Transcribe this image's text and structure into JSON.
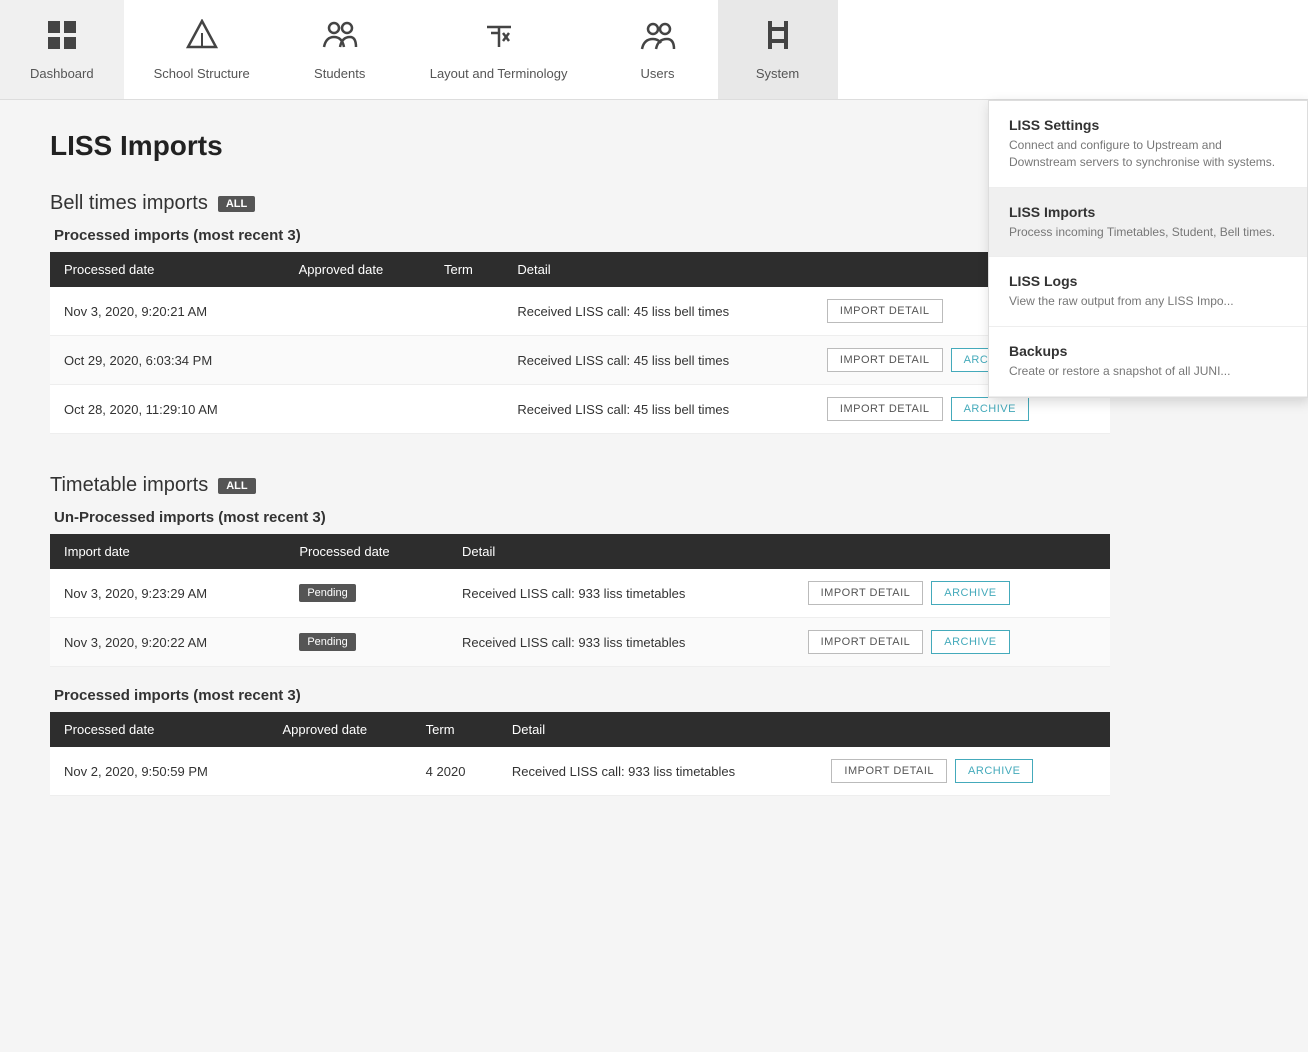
{
  "nav": {
    "items": [
      {
        "id": "dashboard",
        "label": "Dashboard",
        "icon": "⊞"
      },
      {
        "id": "school-structure",
        "label": "School Structure",
        "icon": "△"
      },
      {
        "id": "students",
        "label": "Students",
        "icon": "👥"
      },
      {
        "id": "layout-terminology",
        "label": "Layout and Terminology",
        "icon": "✂"
      },
      {
        "id": "users",
        "label": "Users",
        "icon": "👤"
      },
      {
        "id": "system",
        "label": "System",
        "icon": "⚙"
      }
    ],
    "active": "system"
  },
  "dropdown": {
    "items": [
      {
        "id": "liss-settings",
        "title": "LISS Settings",
        "desc": "Connect and configure to Upstream and Downstream servers to synchronise with systems."
      },
      {
        "id": "liss-imports",
        "title": "LISS Imports",
        "desc": "Process incoming Timetables, Student, Bell times.",
        "active": true
      },
      {
        "id": "liss-logs",
        "title": "LISS Logs",
        "desc": "View the raw output from any LISS Impo..."
      },
      {
        "id": "backups",
        "title": "Backups",
        "desc": "Create or restore a snapshot of all JUNI..."
      }
    ]
  },
  "page": {
    "title": "LISS Imports"
  },
  "bell_times": {
    "section_title": "Bell times imports",
    "badge": "ALL",
    "processed_title": "Processed imports (most recent 3)",
    "table_headers": [
      "Processed date",
      "Approved date",
      "Term",
      "Detail"
    ],
    "rows": [
      {
        "processed_date": "Nov 3, 2020, 9:20:21 AM",
        "approved_date": "",
        "term": "",
        "detail": "Received LISS call: 45 liss bell times",
        "show_archive": false
      },
      {
        "processed_date": "Oct 29, 2020, 6:03:34 PM",
        "approved_date": "",
        "term": "",
        "detail": "Received LISS call: 45 liss bell times",
        "show_archive": true
      },
      {
        "processed_date": "Oct 28, 2020, 11:29:10 AM",
        "approved_date": "",
        "term": "",
        "detail": "Received LISS call: 45 liss bell times",
        "show_archive": true
      }
    ],
    "btn_import_detail": "IMPORT DETAIL",
    "btn_archive": "ARCHIVE"
  },
  "timetable": {
    "section_title": "Timetable imports",
    "badge": "ALL",
    "unprocessed_title": "Un-Processed imports (most recent 3)",
    "unprocessed_headers": [
      "Import date",
      "Processed date",
      "Detail"
    ],
    "unprocessed_rows": [
      {
        "import_date": "Nov 3, 2020, 9:23:29 AM",
        "processed_date_badge": "Pending",
        "detail": "Received LISS call: 933 liss timetables"
      },
      {
        "import_date": "Nov 3, 2020, 9:20:22 AM",
        "processed_date_badge": "Pending",
        "detail": "Received LISS call: 933 liss timetables"
      }
    ],
    "processed_title": "Processed imports (most recent 3)",
    "processed_headers": [
      "Processed date",
      "Approved date",
      "Term",
      "Detail"
    ],
    "processed_rows": [
      {
        "processed_date": "Nov 2, 2020, 9:50:59 PM",
        "approved_date": "",
        "term": "4 2020",
        "detail": "Received LISS call: 933 liss timetables",
        "show_archive": true
      }
    ],
    "btn_import_detail": "IMPORT DETAIL",
    "btn_archive": "ARCHIVE",
    "badge_pending": "Pending"
  }
}
